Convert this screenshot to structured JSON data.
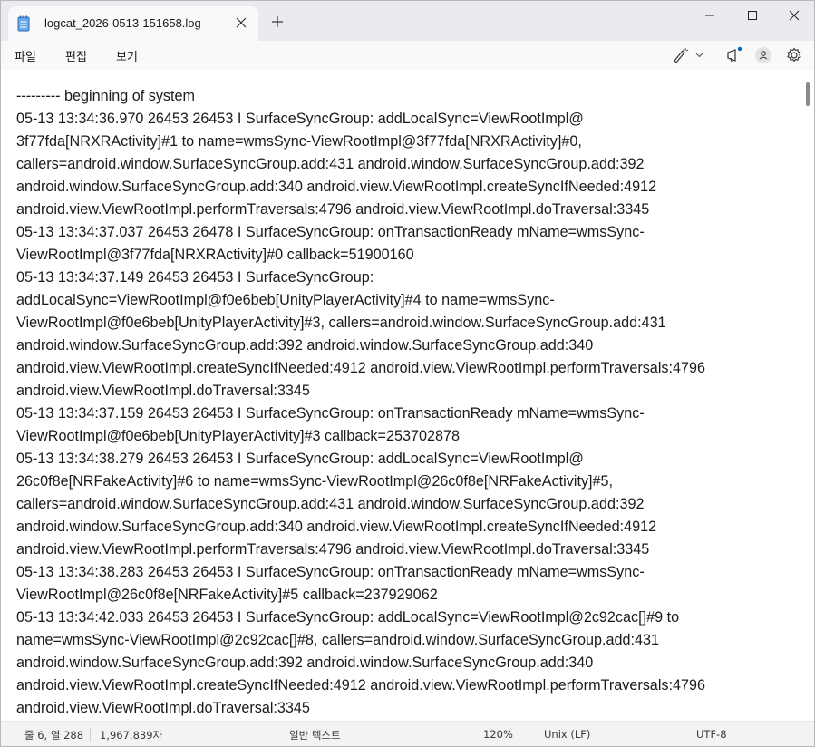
{
  "tab": {
    "title": "logcat_2026-0513-151658.log",
    "icon": "notepad-icon"
  },
  "menu": {
    "file": "파일",
    "edit": "편집",
    "view": "보기"
  },
  "editor": {
    "lines": [
      "--------- beginning of system",
      "05-13 13:34:36.970 26453 26453 I SurfaceSyncGroup: addLocalSync=ViewRootImpl@",
      "3f77fda[NRXRActivity]#1 to name=wmsSync-ViewRootImpl@3f77fda[NRXRActivity]#0,",
      "callers=android.window.SurfaceSyncGroup.add:431 android.window.SurfaceSyncGroup.add:392",
      "android.window.SurfaceSyncGroup.add:340 android.view.ViewRootImpl.createSyncIfNeeded:4912",
      "android.view.ViewRootImpl.performTraversals:4796 android.view.ViewRootImpl.doTraversal:3345",
      "05-13 13:34:37.037 26453 26478 I SurfaceSyncGroup: onTransactionReady mName=wmsSync-",
      "ViewRootImpl@3f77fda[NRXRActivity]#0 callback=51900160",
      "05-13 13:34:37.149 26453 26453 I SurfaceSyncGroup:",
      "addLocalSync=ViewRootImpl@f0e6beb[UnityPlayerActivity]#4 to name=wmsSync-",
      "ViewRootImpl@f0e6beb[UnityPlayerActivity]#3, callers=android.window.SurfaceSyncGroup.add:431",
      "android.window.SurfaceSyncGroup.add:392 android.window.SurfaceSyncGroup.add:340",
      "android.view.ViewRootImpl.createSyncIfNeeded:4912 android.view.ViewRootImpl.performTraversals:4796",
      "android.view.ViewRootImpl.doTraversal:3345",
      "05-13 13:34:37.159 26453 26453 I SurfaceSyncGroup: onTransactionReady mName=wmsSync-",
      "ViewRootImpl@f0e6beb[UnityPlayerActivity]#3 callback=253702878",
      "05-13 13:34:38.279 26453 26453 I SurfaceSyncGroup: addLocalSync=ViewRootImpl@",
      "26c0f8e[NRFakeActivity]#6 to name=wmsSync-ViewRootImpl@26c0f8e[NRFakeActivity]#5,",
      "callers=android.window.SurfaceSyncGroup.add:431 android.window.SurfaceSyncGroup.add:392",
      "android.window.SurfaceSyncGroup.add:340 android.view.ViewRootImpl.createSyncIfNeeded:4912",
      "android.view.ViewRootImpl.performTraversals:4796 android.view.ViewRootImpl.doTraversal:3345",
      "05-13 13:34:38.283 26453 26453 I SurfaceSyncGroup: onTransactionReady mName=wmsSync-",
      "ViewRootImpl@26c0f8e[NRFakeActivity]#5 callback=237929062",
      "05-13 13:34:42.033 26453 26453 I SurfaceSyncGroup: addLocalSync=ViewRootImpl@2c92cac[]#9 to",
      "name=wmsSync-ViewRootImpl@2c92cac[]#8, callers=android.window.SurfaceSyncGroup.add:431",
      "android.window.SurfaceSyncGroup.add:392 android.window.SurfaceSyncGroup.add:340",
      "android.view.ViewRootImpl.createSyncIfNeeded:4912 android.view.ViewRootImpl.performTraversals:4796",
      "android.view.ViewRootImpl.doTraversal:3345"
    ]
  },
  "status": {
    "position": "줄 6, 열 288",
    "chars": "1,967,839자",
    "format": "일반 텍스트",
    "zoom": "120%",
    "eol": "Unix (LF)",
    "encoding": "UTF-8"
  },
  "colors": {
    "accent": "#0067c0",
    "titlebar": "#e9ebf0",
    "tab": "#f9f9f9"
  }
}
